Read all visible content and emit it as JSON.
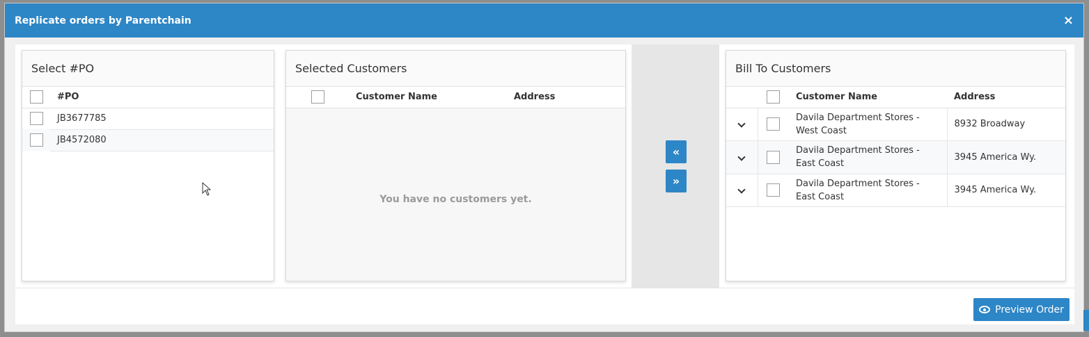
{
  "modal": {
    "title": "Replicate orders by Parentchain",
    "close_label": "×"
  },
  "po_panel": {
    "title": "Select #PO",
    "column_header": "#PO",
    "rows": [
      "JB3677785",
      "JB4572080"
    ]
  },
  "selected_panel": {
    "title": "Selected Customers",
    "columns": [
      "Customer Name",
      "Address"
    ],
    "empty_message": "You have no customers yet."
  },
  "transfer": {
    "move_left_label": "«",
    "move_right_label": "»"
  },
  "bill_panel": {
    "title": "Bill To Customers",
    "columns": [
      "Customer Name",
      "Address"
    ],
    "rows": [
      {
        "name": "Davila Department Stores - West Coast",
        "address": "8932 Broadway"
      },
      {
        "name": "Davila Department Stores - East Coast",
        "address": "3945 America Wy."
      },
      {
        "name": "Davila Department Stores - East Coast",
        "address": "3945 America Wy."
      }
    ]
  },
  "footer": {
    "preview_label": "Preview Order"
  }
}
